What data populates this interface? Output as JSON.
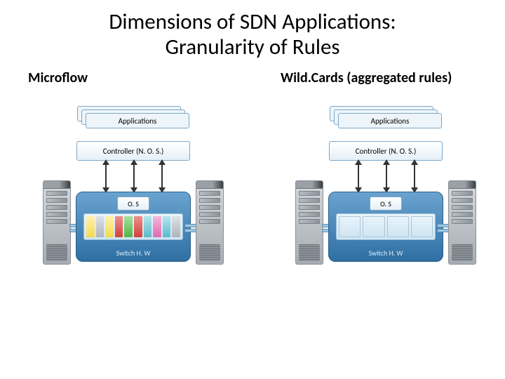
{
  "title_line1": "Dimensions of SDN Applications:",
  "title_line2": "Granularity of Rules",
  "left": {
    "heading": "Microflow",
    "apps_label": "Applications",
    "controller_label": "Controller (N. O. S.)",
    "os_label": "O. S",
    "switch_label": "Switch H. W"
  },
  "right": {
    "heading": "Wild.Cards (aggregated rules)",
    "apps_label": "Applications",
    "controller_label": "Controller (N. O. S.)",
    "os_label": "O. S",
    "switch_label": "Switch H. W"
  }
}
